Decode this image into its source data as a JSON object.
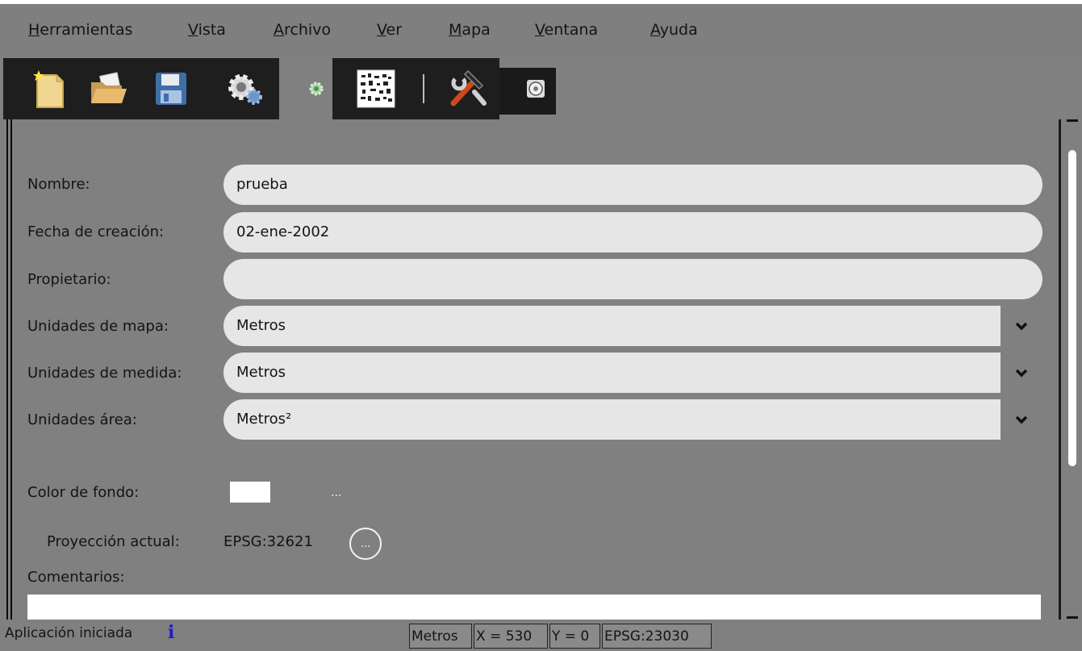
{
  "menu": [
    {
      "label": "Herramientas",
      "accel": "H",
      "rest": "erramientas"
    },
    {
      "label": "Vista",
      "accel": "V",
      "rest": "ista"
    },
    {
      "label": "Archivo",
      "accel": "A",
      "rest": "rchivo"
    },
    {
      "label": "Ver",
      "accel": "V",
      "rest": "er"
    },
    {
      "label": "Mapa",
      "accel": "M",
      "rest": "apa"
    },
    {
      "label": "Ventana",
      "accel": "V",
      "rest": "entana"
    },
    {
      "label": "Ayuda",
      "accel": "A",
      "rest": "yuda"
    }
  ],
  "toolbar": {
    "icons": [
      "new-document-icon",
      "open-folder-icon",
      "save-icon",
      "preferences-gear-icon",
      "small-gear-icon",
      "locator-map-icon",
      "tools-icon",
      "options-disc-icon"
    ]
  },
  "form": {
    "name_label": "Nombre:",
    "name_value": "prueba",
    "date_label": "Fecha de creación:",
    "date_value": "02-ene-2002",
    "owner_label": "Propietario:",
    "owner_value": "",
    "map_units_label": "Unidades de mapa:",
    "map_units_value": "Metros",
    "measure_units_label": "Unidades de medida:",
    "measure_units_value": "Metros",
    "area_units_label": "Unidades área:",
    "area_units_value": "Metros²",
    "bg_color_label": "Color de fondo:",
    "bg_color": "#ffffff",
    "bg_color_more": "...",
    "projection_label": "Proyección actual:",
    "projection_value": "EPSG:32621",
    "projection_button": "...",
    "comments_label": "Comentarios:",
    "comments_value": ""
  },
  "status": {
    "message": "Aplicación iniciada",
    "info_icon": "i",
    "units": "Metros",
    "x": "X = 530",
    "y": "Y = 0",
    "crs": "EPSG:23030"
  },
  "colors": {
    "background": "#808080",
    "toolbar_bg": "#1e1e1e",
    "field_bg": "#e6e6e6",
    "info_icon": "#1a1ad8"
  }
}
